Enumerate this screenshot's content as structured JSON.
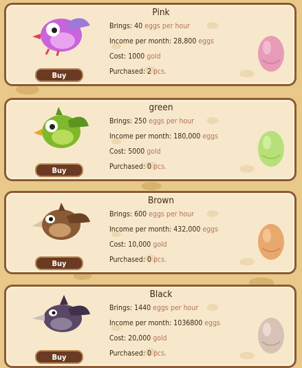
{
  "labels": {
    "brings": "Brings:",
    "income": "Income per month:",
    "cost": "Cost:",
    "purchased": "Purchased:",
    "eggs_per_hour": "eggs per hour",
    "eggs": "eggs",
    "gold": "gold",
    "pcs": "pcs.",
    "buy": "Buy"
  },
  "birds": [
    {
      "name": "Pink",
      "brings": "40",
      "income": "28,800",
      "cost": "1000",
      "purchased": "2",
      "colors": {
        "body": "#c964dc",
        "belly": "#e8a4f0",
        "wing": "#9d7ad8",
        "egg": "#e79bb7",
        "egg_shade": "#c66f98"
      }
    },
    {
      "name": "green",
      "brings": "250",
      "income": "180,000",
      "cost": "5000",
      "purchased": "0",
      "colors": {
        "body": "#7fb82b",
        "belly": "#b9dc5c",
        "wing": "#5d9420",
        "egg": "#b7e07a",
        "egg_shade": "#83b73e"
      }
    },
    {
      "name": "Brown",
      "brings": "600",
      "income": "432,000",
      "cost": "10,000",
      "purchased": "0",
      "colors": {
        "body": "#8a5a34",
        "belly": "#c89a6a",
        "wing": "#6b4226",
        "egg": "#e9a86e",
        "egg_shade": "#c27a45"
      }
    },
    {
      "name": "Black",
      "brings": "1440",
      "income": "1036800",
      "cost": "20,000",
      "purchased": "0",
      "colors": {
        "body": "#5a4766",
        "belly": "#8d7e99",
        "wing": "#3f3149",
        "egg": "#d8c2b6",
        "egg_shade": "#a88f83"
      }
    }
  ]
}
